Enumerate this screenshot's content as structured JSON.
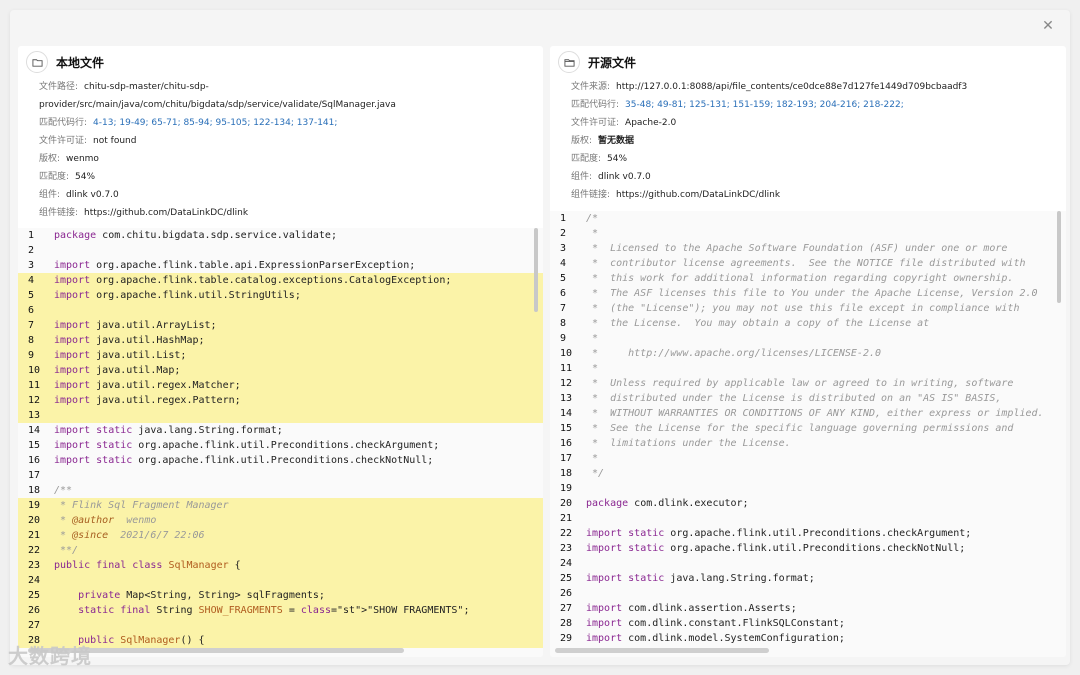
{
  "close_icon": "close-icon",
  "left": {
    "title": "本地文件",
    "meta": [
      {
        "k": "文件路径:",
        "v": "chitu-sdp-master/chitu-sdp-provider/src/main/java/com/chitu/bigdata/sdp/service/validate/SqlManager.java",
        "style": ""
      },
      {
        "k": "匹配代码行:",
        "v": "4-13; 19-49; 65-71; 85-94; 95-105; 122-134; 137-141;",
        "style": "blue"
      },
      {
        "k": "文件许可证:",
        "v": "not found",
        "style": ""
      },
      {
        "k": "版权:",
        "v": "wenmo",
        "style": ""
      },
      {
        "k": "匹配度:",
        "v": "54%",
        "style": ""
      },
      {
        "k": "组件:",
        "v": "dlink v0.7.0",
        "style": ""
      },
      {
        "k": "组件链接:",
        "v": "https://github.com/DataLinkDC/dlink",
        "style": ""
      }
    ],
    "code": [
      {
        "n": "1",
        "t": "package com.chitu.bigdata.sdp.service.validate;",
        "hl": false
      },
      {
        "n": "2",
        "t": "",
        "hl": false
      },
      {
        "n": "3",
        "t": "import org.apache.flink.table.api.ExpressionParserException;",
        "hl": false
      },
      {
        "n": "4",
        "t": "import org.apache.flink.table.catalog.exceptions.CatalogException;",
        "hl": true
      },
      {
        "n": "5",
        "t": "import org.apache.flink.util.StringUtils;",
        "hl": true
      },
      {
        "n": "6",
        "t": "",
        "hl": true
      },
      {
        "n": "7",
        "t": "import java.util.ArrayList;",
        "hl": true
      },
      {
        "n": "8",
        "t": "import java.util.HashMap;",
        "hl": true
      },
      {
        "n": "9",
        "t": "import java.util.List;",
        "hl": true
      },
      {
        "n": "10",
        "t": "import java.util.Map;",
        "hl": true
      },
      {
        "n": "11",
        "t": "import java.util.regex.Matcher;",
        "hl": true
      },
      {
        "n": "12",
        "t": "import java.util.regex.Pattern;",
        "hl": true
      },
      {
        "n": "13",
        "t": "",
        "hl": true
      },
      {
        "n": "14",
        "t": "import static java.lang.String.format;",
        "hl": false
      },
      {
        "n": "15",
        "t": "import static org.apache.flink.util.Preconditions.checkArgument;",
        "hl": false
      },
      {
        "n": "16",
        "t": "import static org.apache.flink.util.Preconditions.checkNotNull;",
        "hl": false
      },
      {
        "n": "17",
        "t": "",
        "hl": false
      },
      {
        "n": "18",
        "t": "/**",
        "hl": false
      },
      {
        "n": "19",
        "t": " * Flink Sql Fragment Manager",
        "hl": true
      },
      {
        "n": "20",
        "t": " * @author  wenmo",
        "hl": true
      },
      {
        "n": "21",
        "t": " * @since  2021/6/7 22:06",
        "hl": true
      },
      {
        "n": "22",
        "t": " **/",
        "hl": true
      },
      {
        "n": "23",
        "t": "public final class SqlManager {",
        "hl": true
      },
      {
        "n": "24",
        "t": "",
        "hl": true
      },
      {
        "n": "25",
        "t": "    private Map<String, String> sqlFragments;",
        "hl": true
      },
      {
        "n": "26",
        "t": "    static final String SHOW_FRAGMENTS = \"SHOW FRAGMENTS\";",
        "hl": true
      },
      {
        "n": "27",
        "t": "",
        "hl": true
      },
      {
        "n": "28",
        "t": "    public SqlManager() {",
        "hl": true
      }
    ]
  },
  "right": {
    "title": "开源文件",
    "meta": [
      {
        "k": "文件来源:",
        "v": "http://127.0.0.1:8088/api/file_contents/ce0dce88e7d127fe1449d709bcbaadf3",
        "style": ""
      },
      {
        "k": "匹配代码行:",
        "v": "35-48; 49-81; 125-131; 151-159; 182-193; 204-216; 218-222;",
        "style": "blue"
      },
      {
        "k": "文件许可证:",
        "v": "Apache-2.0",
        "style": ""
      },
      {
        "k": "版权:",
        "v": "暂无数据",
        "style": "bold"
      },
      {
        "k": "匹配度:",
        "v": "54%",
        "style": ""
      },
      {
        "k": "组件:",
        "v": "dlink v0.7.0",
        "style": ""
      },
      {
        "k": "组件链接:",
        "v": "https://github.com/DataLinkDC/dlink",
        "style": ""
      }
    ],
    "code": [
      {
        "n": "1",
        "t": "/*",
        "hl": false
      },
      {
        "n": "2",
        "t": " *",
        "hl": false
      },
      {
        "n": "3",
        "t": " *  Licensed to the Apache Software Foundation (ASF) under one or more",
        "hl": false
      },
      {
        "n": "4",
        "t": " *  contributor license agreements.  See the NOTICE file distributed with",
        "hl": false
      },
      {
        "n": "5",
        "t": " *  this work for additional information regarding copyright ownership.",
        "hl": false
      },
      {
        "n": "6",
        "t": " *  The ASF licenses this file to You under the Apache License, Version 2.0",
        "hl": false
      },
      {
        "n": "7",
        "t": " *  (the \"License\"); you may not use this file except in compliance with",
        "hl": false
      },
      {
        "n": "8",
        "t": " *  the License.  You may obtain a copy of the License at",
        "hl": false
      },
      {
        "n": "9",
        "t": " *",
        "hl": false
      },
      {
        "n": "10",
        "t": " *     http://www.apache.org/licenses/LICENSE-2.0",
        "hl": false
      },
      {
        "n": "11",
        "t": " *",
        "hl": false
      },
      {
        "n": "12",
        "t": " *  Unless required by applicable law or agreed to in writing, software",
        "hl": false
      },
      {
        "n": "13",
        "t": " *  distributed under the License is distributed on an \"AS IS\" BASIS,",
        "hl": false
      },
      {
        "n": "14",
        "t": " *  WITHOUT WARRANTIES OR CONDITIONS OF ANY KIND, either express or implied.",
        "hl": false
      },
      {
        "n": "15",
        "t": " *  See the License for the specific language governing permissions and",
        "hl": false
      },
      {
        "n": "16",
        "t": " *  limitations under the License.",
        "hl": false
      },
      {
        "n": "17",
        "t": " *",
        "hl": false
      },
      {
        "n": "18",
        "t": " */",
        "hl": false
      },
      {
        "n": "19",
        "t": "",
        "hl": false
      },
      {
        "n": "20",
        "t": "package com.dlink.executor;",
        "hl": false
      },
      {
        "n": "21",
        "t": "",
        "hl": false
      },
      {
        "n": "22",
        "t": "import static org.apache.flink.util.Preconditions.checkArgument;",
        "hl": false
      },
      {
        "n": "23",
        "t": "import static org.apache.flink.util.Preconditions.checkNotNull;",
        "hl": false
      },
      {
        "n": "24",
        "t": "",
        "hl": false
      },
      {
        "n": "25",
        "t": "import static java.lang.String.format;",
        "hl": false
      },
      {
        "n": "26",
        "t": "",
        "hl": false
      },
      {
        "n": "27",
        "t": "import com.dlink.assertion.Asserts;",
        "hl": false
      },
      {
        "n": "28",
        "t": "import com.dlink.constant.FlinkSQLConstant;",
        "hl": false
      },
      {
        "n": "29",
        "t": "import com.dlink.model.SystemConfiguration;",
        "hl": false
      }
    ]
  },
  "watermark": "大数跨境"
}
